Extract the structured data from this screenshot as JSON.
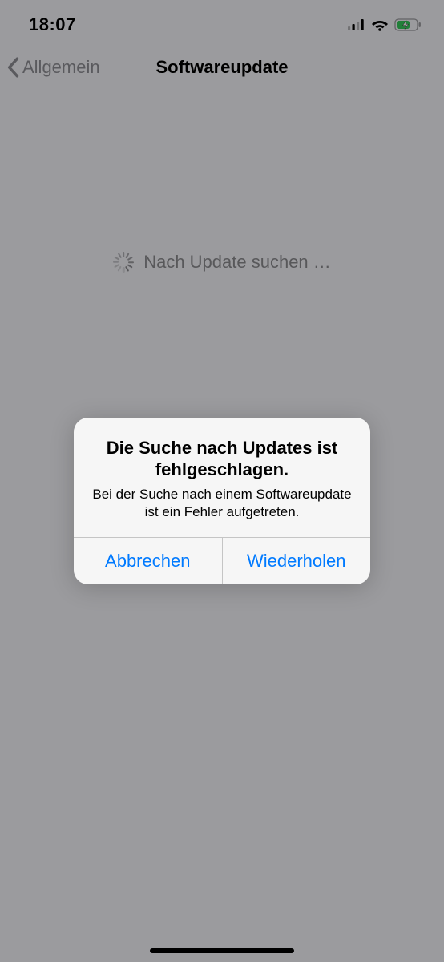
{
  "status": {
    "time": "18:07"
  },
  "nav": {
    "back_label": "Allgemein",
    "title": "Softwareupdate"
  },
  "content": {
    "searching_text": "Nach Update suchen …"
  },
  "alert": {
    "title": "Die Suche nach Updates ist fehlgeschlagen.",
    "message": "Bei der Suche nach einem Softwareupdate ist ein Fehler aufgetreten.",
    "cancel": "Abbrechen",
    "retry": "Wiederholen"
  }
}
